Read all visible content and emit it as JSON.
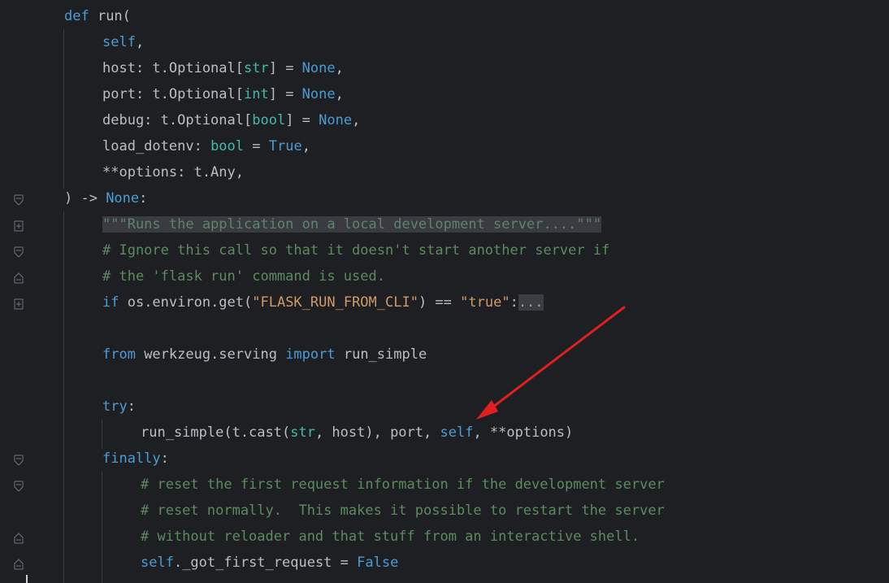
{
  "editor": {
    "language": "python",
    "lines": [
      {
        "id": "l1",
        "tokens": [
          {
            "t": "def ",
            "c": "blue"
          },
          {
            "t": "run(",
            "c": "plain"
          }
        ]
      },
      {
        "id": "l2",
        "tokens": [
          {
            "t": "self",
            "c": "blue"
          },
          {
            "t": ",",
            "c": "plain"
          }
        ]
      },
      {
        "id": "l3",
        "tokens": [
          {
            "t": "host: t.Optional[",
            "c": "plain"
          },
          {
            "t": "str",
            "c": "teal"
          },
          {
            "t": "] = ",
            "c": "plain"
          },
          {
            "t": "None",
            "c": "blue"
          },
          {
            "t": ",",
            "c": "plain"
          }
        ]
      },
      {
        "id": "l4",
        "tokens": [
          {
            "t": "port: t.Optional[",
            "c": "plain"
          },
          {
            "t": "int",
            "c": "teal"
          },
          {
            "t": "] = ",
            "c": "plain"
          },
          {
            "t": "None",
            "c": "blue"
          },
          {
            "t": ",",
            "c": "plain"
          }
        ]
      },
      {
        "id": "l5",
        "tokens": [
          {
            "t": "debug: t.Optional[",
            "c": "plain"
          },
          {
            "t": "bool",
            "c": "teal"
          },
          {
            "t": "] = ",
            "c": "plain"
          },
          {
            "t": "None",
            "c": "blue"
          },
          {
            "t": ",",
            "c": "plain"
          }
        ]
      },
      {
        "id": "l6",
        "tokens": [
          {
            "t": "load_dotenv: ",
            "c": "plain"
          },
          {
            "t": "bool",
            "c": "teal"
          },
          {
            "t": " = ",
            "c": "plain"
          },
          {
            "t": "True",
            "c": "blue"
          },
          {
            "t": ",",
            "c": "plain"
          }
        ]
      },
      {
        "id": "l7",
        "tokens": [
          {
            "t": "**options: t.Any,",
            "c": "plain"
          }
        ]
      },
      {
        "id": "l8",
        "tokens": [
          {
            "t": ") -> ",
            "c": "plain"
          },
          {
            "t": "None",
            "c": "blue"
          },
          {
            "t": ":",
            "c": "plain"
          }
        ]
      },
      {
        "id": "l9",
        "tokens": [
          {
            "t": "\"\"\"Runs the application on a local development server....\"\"\"",
            "c": "doc"
          }
        ]
      },
      {
        "id": "l10",
        "tokens": [
          {
            "t": "# Ignore this call so that it doesn't start another server if",
            "c": "green-c"
          }
        ]
      },
      {
        "id": "l11",
        "tokens": [
          {
            "t": "# the 'flask run' command is used.",
            "c": "green-c"
          }
        ]
      },
      {
        "id": "l12",
        "tokens": [
          {
            "t": "if ",
            "c": "blue"
          },
          {
            "t": "os.environ.get(",
            "c": "plain"
          },
          {
            "t": "\"FLASK_RUN_FROM_CLI\"",
            "c": "orange"
          },
          {
            "t": ") == ",
            "c": "plain"
          },
          {
            "t": "\"true\"",
            "c": "orange"
          },
          {
            "t": ":",
            "c": "plain"
          },
          {
            "t": "...",
            "c": "placeholder"
          }
        ]
      },
      {
        "id": "l13",
        "tokens": []
      },
      {
        "id": "l14",
        "tokens": [
          {
            "t": "from ",
            "c": "blue"
          },
          {
            "t": "werkzeug.serving ",
            "c": "plain"
          },
          {
            "t": "import ",
            "c": "blue"
          },
          {
            "t": "run_simple",
            "c": "plain"
          }
        ]
      },
      {
        "id": "l15",
        "tokens": []
      },
      {
        "id": "l16",
        "tokens": [
          {
            "t": "try",
            "c": "blue"
          },
          {
            "t": ":",
            "c": "plain"
          }
        ]
      },
      {
        "id": "l17",
        "tokens": [
          {
            "t": "run_simple(t.cast(",
            "c": "plain"
          },
          {
            "t": "str",
            "c": "teal"
          },
          {
            "t": ", host), port, ",
            "c": "plain"
          },
          {
            "t": "self",
            "c": "blue"
          },
          {
            "t": ", **options)",
            "c": "plain"
          }
        ]
      },
      {
        "id": "l18",
        "tokens": [
          {
            "t": "finally",
            "c": "blue"
          },
          {
            "t": ":",
            "c": "plain"
          }
        ]
      },
      {
        "id": "l19",
        "tokens": [
          {
            "t": "# reset the first request information if the development server",
            "c": "green-c"
          }
        ]
      },
      {
        "id": "l20",
        "tokens": [
          {
            "t": "# reset normally.  This makes it possible to restart the server",
            "c": "green-c"
          }
        ]
      },
      {
        "id": "l21",
        "tokens": [
          {
            "t": "# without reloader and that stuff from an interactive shell.",
            "c": "green-c"
          }
        ]
      },
      {
        "id": "l22",
        "tokens": [
          {
            "t": "self",
            "c": "blue"
          },
          {
            "t": "._got_first_request = ",
            "c": "plain"
          },
          {
            "t": "False",
            "c": "blue"
          }
        ]
      }
    ]
  },
  "colors": {
    "background": "#1e1f22",
    "text": "#bcbec4",
    "keyword": "#4a9cd6",
    "builtin": "#45b8a8",
    "string": "#d19a66",
    "comment": "#5c8b5f",
    "docstring_bg": "#393b40",
    "annotation_arrow": "#e02020"
  },
  "icons": {
    "fold_open": "fold-open-icon",
    "fold_close": "fold-close-icon",
    "fold_collapsed": "fold-collapsed-icon"
  }
}
